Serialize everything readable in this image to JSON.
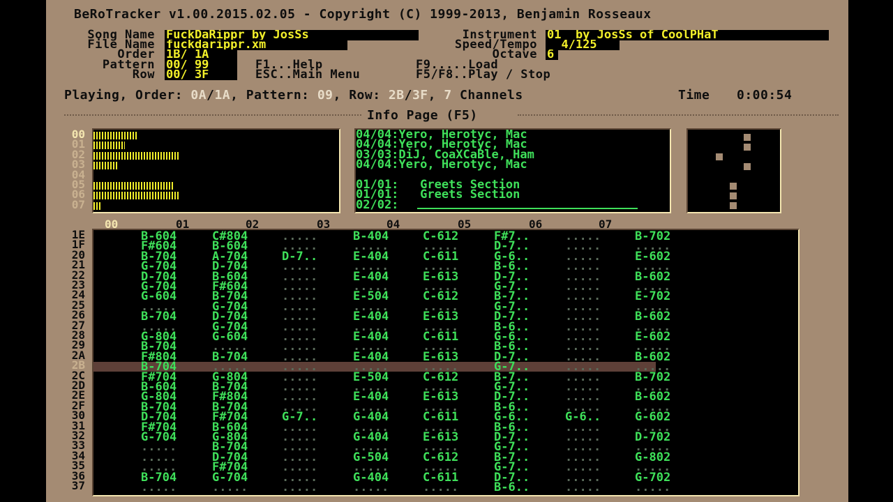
{
  "header": {
    "title": "BeRoTracker v1.00.2015.02.05 - Copyright (C) 1999-2013, Benjamin Rosseaux",
    "song_name_label": "Song Name",
    "song_name": "FuckDaRippr by JosSs",
    "file_name_label": "File Name",
    "file_name": "fuckdarippr.xm",
    "order_label": "Order",
    "order": "1B/ 1A",
    "pattern_label": "Pattern",
    "pattern": "00/ 99",
    "row_label": "Row",
    "row": "00/ 3F",
    "instrument_label": "Instrument",
    "instrument": "01  by JosSs of CoolPHaT",
    "speed_label": "Speed/Tempo",
    "speed": "  4/125",
    "octave_label": "Octave",
    "octave": "6",
    "f1_label": "F1...Help",
    "esc_label": "ESC..Main Menu",
    "f9_label": "F9.....Load",
    "f5_label": "F5/F8..Play / Stop"
  },
  "status": {
    "playing_label": "Playing, Order:",
    "order_cur": "0A",
    "order_sep": "/",
    "order_total": "1A",
    "pattern_label": ", Pattern:",
    "pattern_cur": "09",
    "row_label": ", Row:",
    "row_cur": "2B",
    "row_sep": "/",
    "row_total": "3F",
    "channels_sep": ",",
    "channels_count": "7",
    "channels_label": "Channels",
    "time_label": "Time",
    "time": "0:00:54"
  },
  "info_page_label": "Info Page (F5)",
  "vu": {
    "channels": [
      "00",
      "01",
      "02",
      "03",
      "04",
      "05",
      "06",
      "07"
    ],
    "levels": [
      0.52,
      0.36,
      1.0,
      0.29,
      0,
      0.92,
      0.98,
      0.08
    ]
  },
  "info_lines": [
    "04/04:Yero, Herotyc, Mac",
    "04/04:Yero, Herotyc, Mac",
    "03/03:DiJ, CoaXCaBle, Ham",
    "04/04:Yero, Herotyc, Mac",
    "",
    "01/01:   Greets Section",
    "01/01:   Greets Section",
    "02/02:"
  ],
  "pattern": {
    "channel_headers": [
      "00",
      "01",
      "02",
      "03",
      "04",
      "05",
      "06",
      "07"
    ],
    "selected_channel": "00",
    "current_row": "2B",
    "rows": [
      {
        "row": "1E",
        "cells": [
          "B-604",
          "C#804",
          ".....",
          "B-404",
          "C-612",
          "F#7..",
          ".....",
          "B-702"
        ]
      },
      {
        "row": "1F",
        "cells": [
          "F#604",
          "B-604",
          ".....",
          ".....",
          ".....",
          "D-7..",
          ".....",
          "....."
        ]
      },
      {
        "row": "20",
        "cells": [
          "B-704",
          "A-704",
          "D-7..",
          "E-404",
          "C-611",
          "G-6..",
          ".....",
          "E-602"
        ]
      },
      {
        "row": "21",
        "cells": [
          "G-704",
          "D-704",
          ".....",
          ".....",
          ".....",
          "B-6..",
          ".....",
          "....."
        ]
      },
      {
        "row": "22",
        "cells": [
          "D-704",
          "B-604",
          ".....",
          "E-404",
          "E-613",
          "D-7..",
          ".....",
          "B-602"
        ]
      },
      {
        "row": "23",
        "cells": [
          "G-704",
          "F#604",
          ".....",
          ".....",
          ".....",
          "G-7..",
          ".....",
          "....."
        ]
      },
      {
        "row": "24",
        "cells": [
          "G-604",
          "B-704",
          ".....",
          "E-504",
          "C-612",
          "B-7..",
          ".....",
          "E-702"
        ]
      },
      {
        "row": "25",
        "cells": [
          ".....",
          "G-704",
          ".....",
          ".....",
          ".....",
          "G-7..",
          ".....",
          "....."
        ]
      },
      {
        "row": "26",
        "cells": [
          "B-704",
          "D-704",
          ".....",
          "E-404",
          "E-613",
          "D-7..",
          ".....",
          "B-602"
        ]
      },
      {
        "row": "27",
        "cells": [
          ".....",
          "G-704",
          ".....",
          ".....",
          ".....",
          "B-6..",
          ".....",
          "....."
        ]
      },
      {
        "row": "28",
        "cells": [
          "G-804",
          "G-604",
          ".....",
          "E-404",
          "C-611",
          "G-6..",
          ".....",
          "E-602"
        ]
      },
      {
        "row": "29",
        "cells": [
          "B-704",
          ".....",
          ".....",
          ".....",
          ".....",
          "B-6..",
          ".....",
          "....."
        ]
      },
      {
        "row": "2A",
        "cells": [
          "F#804",
          "B-704",
          ".....",
          "E-404",
          "E-613",
          "D-7..",
          ".....",
          "B-602"
        ]
      },
      {
        "row": "2B",
        "cells": [
          "B-704",
          ".....",
          ".....",
          ".....",
          ".....",
          "G-7..",
          ".....",
          "....."
        ]
      },
      {
        "row": "2C",
        "cells": [
          "F#704",
          "G-804",
          ".....",
          "E-504",
          "C-612",
          "B-7..",
          ".....",
          "B-702"
        ]
      },
      {
        "row": "2D",
        "cells": [
          "B-604",
          "B-704",
          ".....",
          ".....",
          ".....",
          "G-7..",
          ".....",
          "....."
        ]
      },
      {
        "row": "2E",
        "cells": [
          "G-804",
          "F#804",
          ".....",
          "E-404",
          "E-613",
          "D-7..",
          ".....",
          "B-602"
        ]
      },
      {
        "row": "2F",
        "cells": [
          "B-704",
          "B-704",
          ".....",
          ".....",
          ".....",
          "B-6..",
          ".....",
          "....."
        ]
      },
      {
        "row": "30",
        "cells": [
          "D-704",
          "F#704",
          "G-7..",
          "G-404",
          "C-611",
          "G-6..",
          "G-6..",
          "G-602"
        ]
      },
      {
        "row": "31",
        "cells": [
          "F#704",
          "B-604",
          ".....",
          ".....",
          ".....",
          "B-6..",
          ".....",
          "....."
        ]
      },
      {
        "row": "32",
        "cells": [
          "G-704",
          "G-804",
          ".....",
          "G-404",
          "E-613",
          "D-7..",
          ".....",
          "D-702"
        ]
      },
      {
        "row": "33",
        "cells": [
          ".....",
          "B-704",
          ".....",
          ".....",
          ".....",
          "G-7..",
          ".....",
          "....."
        ]
      },
      {
        "row": "34",
        "cells": [
          ".....",
          "D-704",
          ".....",
          "G-504",
          "C-612",
          "B-7..",
          ".....",
          "G-802"
        ]
      },
      {
        "row": "35",
        "cells": [
          ".....",
          "F#704",
          ".....",
          ".....",
          ".....",
          "G-7..",
          ".....",
          "....."
        ]
      },
      {
        "row": "36",
        "cells": [
          "B-704",
          "G-704",
          ".....",
          "G-404",
          "C-611",
          "D-7..",
          ".....",
          "G-702"
        ]
      },
      {
        "row": "37",
        "cells": [
          ".....",
          ".....",
          ".....",
          ".....",
          ".....",
          "B-6..",
          ".....",
          "....."
        ]
      }
    ]
  },
  "colors": {
    "background": "#a48b73",
    "panel": "#000000",
    "note": "#3fe05a",
    "field": "#f2ef2a",
    "current_row": "#5e4038"
  }
}
